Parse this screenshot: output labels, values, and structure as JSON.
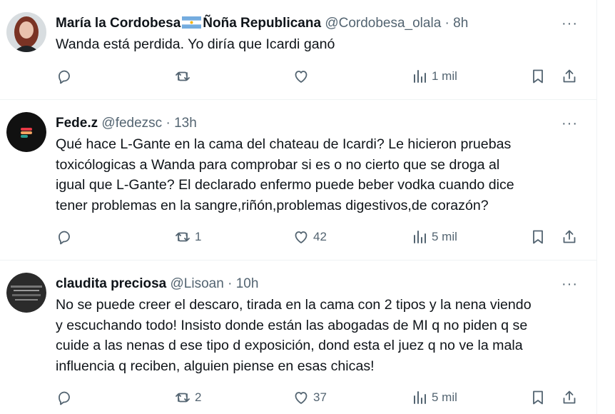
{
  "tweets": [
    {
      "name": "María la Cordobesa",
      "name2": "Ñoña Republicana",
      "handle": "@Cordobesa_olala",
      "sep": "·",
      "time": "8h",
      "text": "Wanda está perdida. Yo diría que Icardi ganó",
      "retweets": "",
      "likes": "",
      "views": "1 mil"
    },
    {
      "name": "Fede.z",
      "handle": "@fedezsc",
      "sep": "·",
      "time": "13h",
      "text_lines": [
        "Qué hace L-Gante en la cama del chateau de Icardi? Le hicieron pruebas",
        "toxicólogicas a Wanda para comprobar si es o no cierto que se droga al",
        "igual que L-Gante? El declarado enfermo puede beber vodka cuando dice",
        "tener problemas en la sangre,riñón,problemas digestivos,de corazón?"
      ],
      "retweets": "1",
      "likes": "42",
      "views": "5 mil"
    },
    {
      "name": "claudita preciosa",
      "handle": "@Lisoan",
      "sep": "·",
      "time": "10h",
      "text_lines": [
        "No se puede creer el descaro, tirada en la cama con 2 tipos y la nena viendo",
        "y escuchando todo! Insisto donde están las abogadas de MI q no piden q se",
        "cuide a las nenas d ese tipo d exposición, dond esta el juez q no ve la mala",
        "influencia q reciben, alguien piense en esas chicas!"
      ],
      "retweets": "2",
      "likes": "37",
      "views": "5 mil"
    }
  ],
  "more_label": "···",
  "icons": [
    "reply-icon",
    "retweet-icon",
    "like-icon",
    "views-icon",
    "bookmark-icon",
    "share-icon"
  ],
  "colors": {
    "text": "#0f1419",
    "secondary": "#536471",
    "divider": "#eff3f4"
  }
}
